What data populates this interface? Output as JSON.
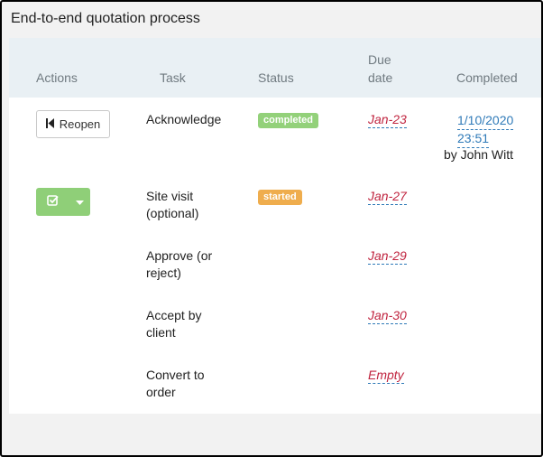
{
  "panel": {
    "title": "End-to-end quotation process"
  },
  "table": {
    "headers": {
      "actions": "Actions",
      "task": "Task",
      "status": "Status",
      "due_line1": "Due",
      "due_line2": "date",
      "completed": "Completed"
    },
    "rows": [
      {
        "action_label": "Reopen",
        "task_line1": "Acknowledge",
        "task_line2": "",
        "status": "completed",
        "due": "Jan-23",
        "completed_line1": "1/10/2020",
        "completed_line2": "23:51",
        "completed_by": "by John Witt"
      },
      {
        "task_line1": "Site visit",
        "task_line2": "(optional)",
        "status": "started",
        "due": "Jan-27"
      },
      {
        "task_line1": "Approve (or",
        "task_line2": "reject)",
        "due": "Jan-29"
      },
      {
        "task_line1": "Accept by",
        "task_line2": "client",
        "due": "Jan-30"
      },
      {
        "task_line1": "Convert to",
        "task_line2": "order",
        "due": "Empty"
      }
    ]
  },
  "colors": {
    "completed_badge": "#93d17a",
    "started_badge": "#efad4d",
    "action_button": "#8fcf78",
    "due_text": "#c0243f",
    "link": "#2f7ab8",
    "header_bg": "#e9f0f4"
  },
  "icons": {
    "reopen": "skip-back-icon",
    "complete": "check-square-icon",
    "dropdown": "caret-down-icon"
  }
}
